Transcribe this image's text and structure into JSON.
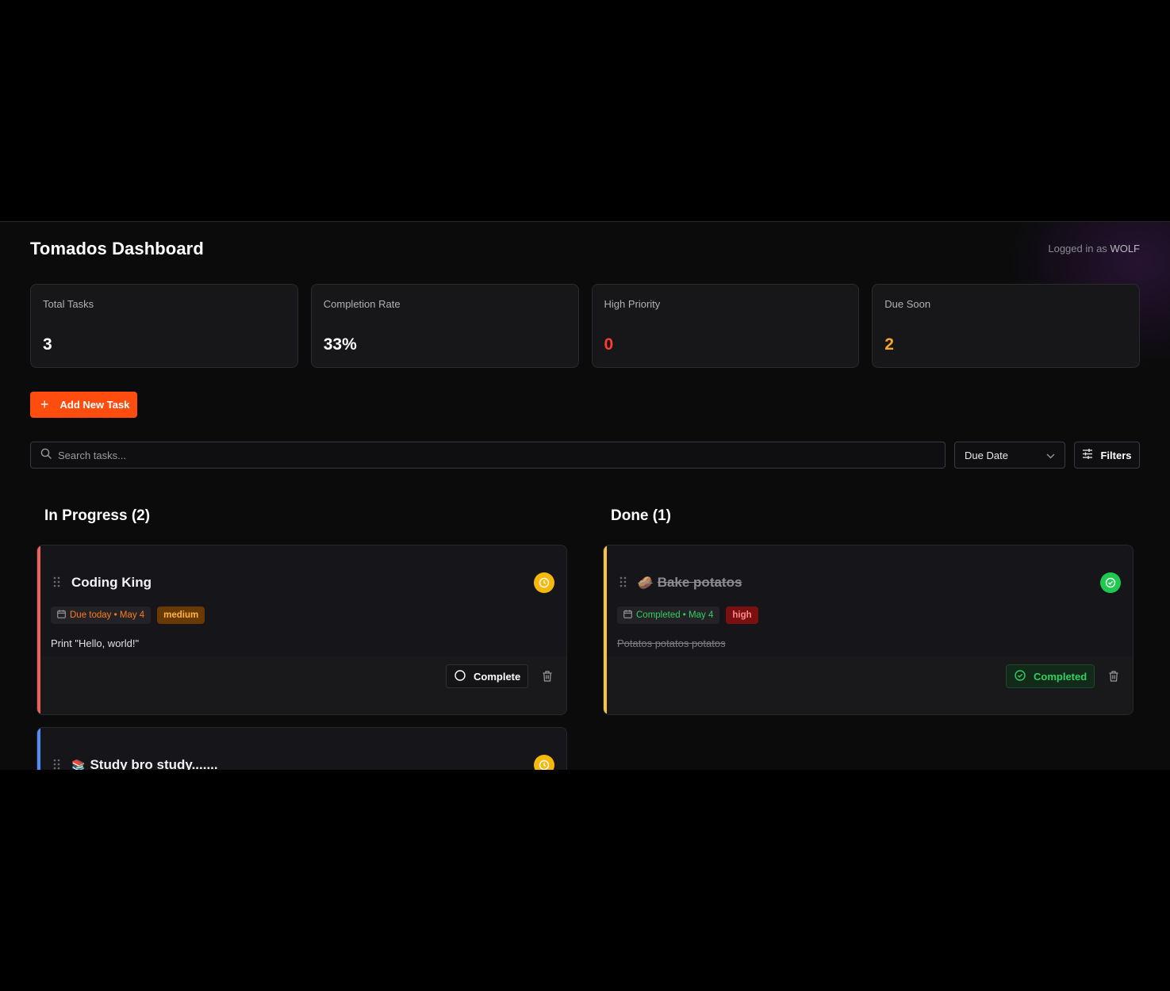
{
  "app": {
    "title": "Tomados Dashboard",
    "logged_in_prefix": "Logged in as",
    "user": "WOLF"
  },
  "stats": [
    {
      "label": "Total Tasks",
      "value": "3",
      "color": "#ffffff"
    },
    {
      "label": "Completion Rate",
      "value": "33%",
      "color": "#ffffff"
    },
    {
      "label": "High Priority",
      "value": "0",
      "color": "#ff3b30"
    },
    {
      "label": "Due Soon",
      "value": "2",
      "color": "#f5a623"
    }
  ],
  "actions": {
    "add_task": "Add New Task"
  },
  "toolbar": {
    "search_placeholder": "Search tasks...",
    "sort_value": "Due Date",
    "filters_label": "Filters"
  },
  "columns": [
    {
      "title": "In Progress (2)",
      "cards": [
        {
          "title": "Coding King",
          "emoji": "",
          "due_text": "Due today • May 4",
          "priority": "medium",
          "description": "Print \"Hello, world!\"",
          "action_label": "Complete",
          "accent": "#f0605d",
          "status_icon": "clock-icon"
        },
        {
          "title": "Study bro study.......",
          "emoji": "📚",
          "accent": "#4f8ff7",
          "status_icon": "clock-icon"
        }
      ]
    },
    {
      "title": "Done (1)",
      "cards": [
        {
          "title": "Bake potatos",
          "emoji": "🥔",
          "due_text": "Completed • May 4",
          "priority": "high",
          "description": "Potatos potatos potatos",
          "action_label": "Completed",
          "accent": "#f5c441",
          "status_icon": "check-circle-icon"
        }
      ]
    }
  ]
}
